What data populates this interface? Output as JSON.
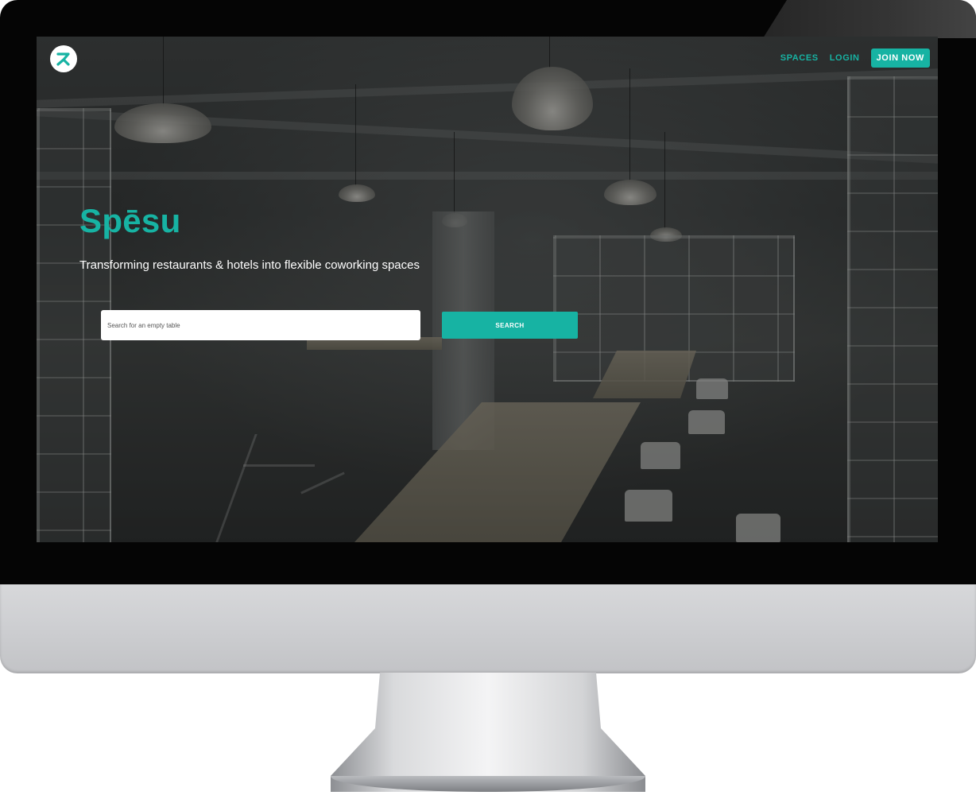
{
  "brand": {
    "logo_icon": "spesu-logo-icon",
    "accent_color": "#17b3a3"
  },
  "nav": {
    "items": [
      {
        "label": "SPACES"
      },
      {
        "label": "LOGIN"
      }
    ],
    "join_label": "JOIN NOW"
  },
  "hero": {
    "title": "Spēsu",
    "subtitle": "Transforming restaurants & hotels into flexible coworking spaces",
    "background_image": "restaurant-interior-photo"
  },
  "search": {
    "placeholder": "Search for an empty table",
    "button_label": "SEARCH"
  }
}
